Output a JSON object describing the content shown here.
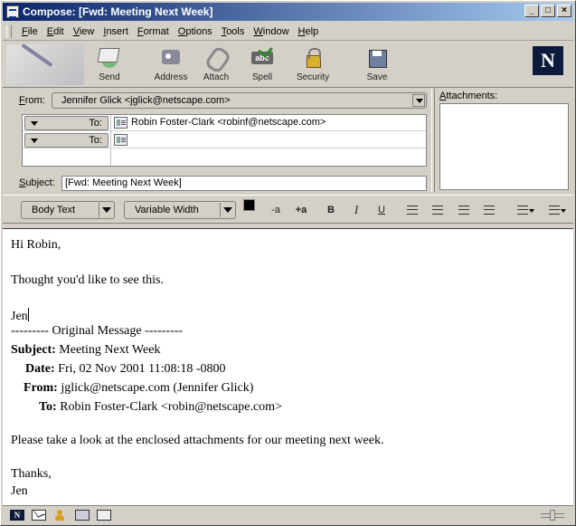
{
  "window": {
    "title": "Compose: [Fwd: Meeting Next Week]",
    "min_label": "_",
    "max_label": "□",
    "close_label": "×"
  },
  "menu": [
    {
      "u": "F",
      "rest": "ile"
    },
    {
      "u": "E",
      "rest": "dit"
    },
    {
      "u": "V",
      "rest": "iew"
    },
    {
      "u": "I",
      "rest": "nsert"
    },
    {
      "u": "F",
      "rest": "ormat"
    },
    {
      "u": "O",
      "rest": "ptions"
    },
    {
      "u": "T",
      "rest": "ools"
    },
    {
      "u": "W",
      "rest": "indow"
    },
    {
      "u": "H",
      "rest": "elp"
    }
  ],
  "toolbar": {
    "send": "Send",
    "address": "Address",
    "attach": "Attach",
    "spell": "Spell",
    "security": "Security",
    "save": "Save",
    "logo": "N"
  },
  "header": {
    "from_u": "F",
    "from_rest": "rom:",
    "from_value": "Jennifer Glick <jglick@netscape.com>",
    "recipients": [
      {
        "type": "To:",
        "value": "Robin Foster-Clark <robinf@netscape.com>"
      },
      {
        "type": "To:",
        "value": ""
      }
    ],
    "subject_u": "S",
    "subject_rest": "ubject:",
    "subject_value": "[Fwd: Meeting Next Week]",
    "attachments_u": "A",
    "attachments_rest": "ttachments:"
  },
  "format": {
    "paragraph_style": "Body Text",
    "font": "Variable Width",
    "smaller": "-a",
    "larger": "+a",
    "bold": "B",
    "italic": "I",
    "underline": "U"
  },
  "body": {
    "greeting": "Hi Robin,",
    "line1": "Thought you'd like to see this.",
    "signoff_short": "Jen",
    "original_header": "--------- Original Message ---------",
    "subject_label": "Subject:",
    "subject_value": "Meeting Next Week",
    "date_label": "Date:",
    "date_value": "Fri, 02 Nov 2001 11:08:18 -0800",
    "from_label": "From:",
    "from_value": "jglick@netscape.com (Jennifer Glick)",
    "to_label": "To:",
    "to_value": "Robin Foster-Clark <robin@netscape.com>",
    "content": "Please take a look at the enclosed attachments for our meeting next week.",
    "thanks": "Thanks,",
    "signature": "Jen"
  },
  "status": {
    "logo": "N"
  }
}
